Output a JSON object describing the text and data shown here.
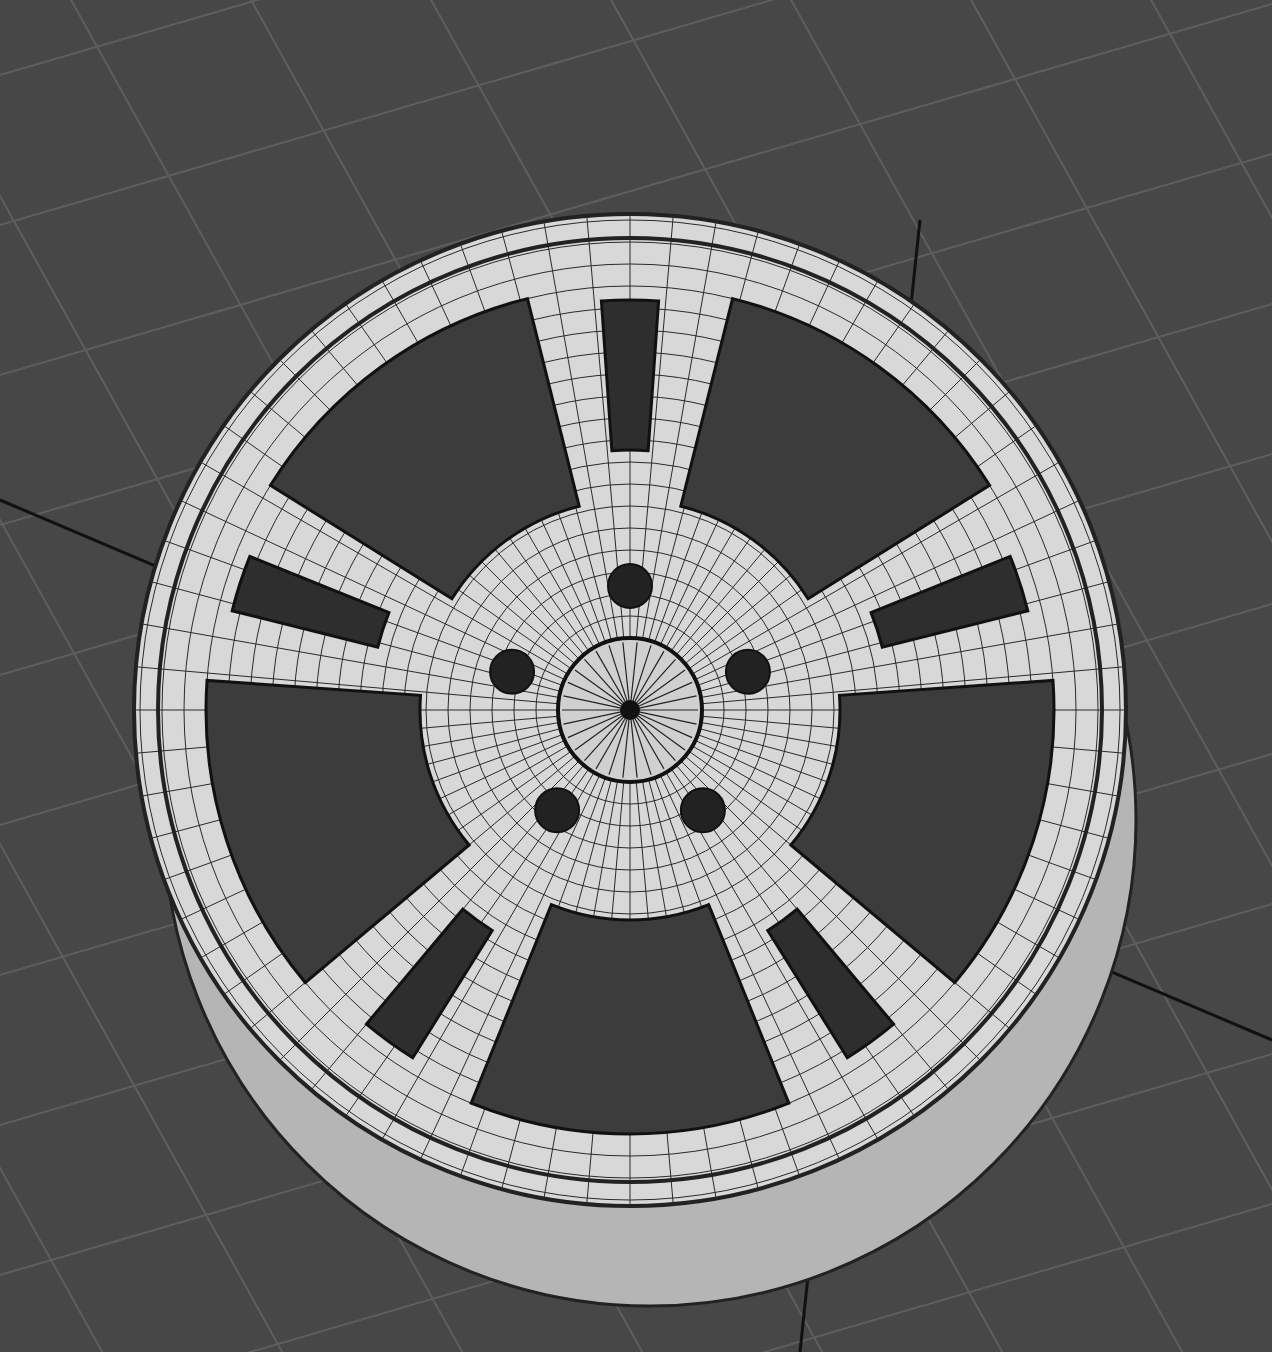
{
  "viewport": {
    "grid": true
  },
  "model": {
    "kind": "wheel"
  }
}
